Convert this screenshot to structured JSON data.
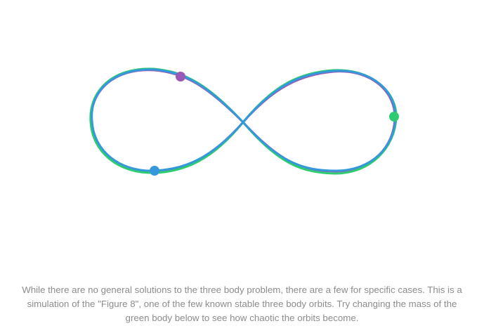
{
  "simulation": {
    "title": "Figure 8",
    "bodies": [
      {
        "name": "purple-body",
        "color": "#9b59b6"
      },
      {
        "name": "green-body",
        "color": "#2ecc71"
      },
      {
        "name": "blue-body",
        "color": "#3498db"
      }
    ],
    "trail_colors": [
      "#9b59b6",
      "#2ecc71",
      "#3498db"
    ]
  },
  "description": {
    "text": "While there are no general solutions to the three body problem, there are a few for specific cases. This is a simulation of the \"Figure 8\", one of the few known stable three body orbits. Try changing the mass of the green body below to see how chaotic the orbits become."
  }
}
